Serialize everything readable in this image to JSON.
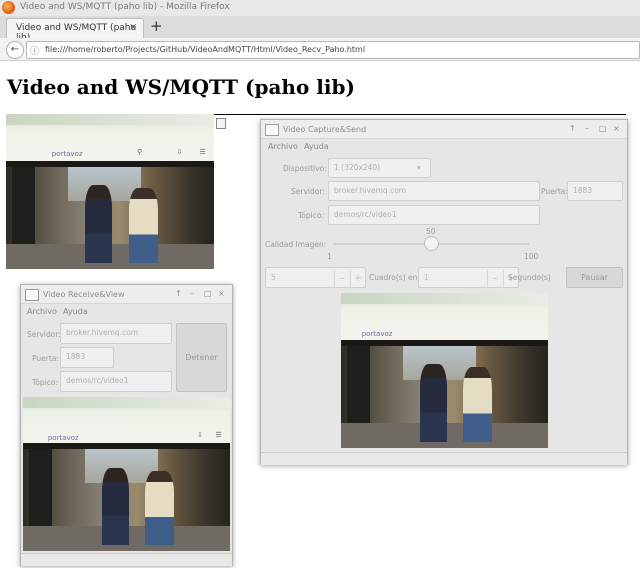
{
  "browser": {
    "window_title": "Video and WS/MQTT (paho lib) - Mozilla Firefox",
    "tab_label": "Video and WS/MQTT (paho lib)",
    "tab_close": "×",
    "new_tab": "+",
    "back": "←",
    "info": "ⓘ",
    "url": "file:///home/roberto/Projects/GitHub/VideoAndMQTT/Html/Video_Recv_Paho.html"
  },
  "page": {
    "title": "Video and WS/MQTT (paho lib)"
  },
  "video": {
    "webpage_caption": "portavoz",
    "icons": [
      "⚲",
      "⇩",
      "☰"
    ]
  },
  "capture_window": {
    "title": "Video Capture&Send",
    "controls": [
      "↑",
      "–",
      "□",
      "×"
    ],
    "menu": [
      "Archivo",
      "Ayuda"
    ],
    "device_label": "Dispositivo:",
    "device_value": "1 (320x240)",
    "device_arrow": "▾",
    "server_label": "Servidor:",
    "server_value": "broker.hivemq.com",
    "port_label": "Puerta:",
    "port_value": "1883",
    "topic_label": "Tópico:",
    "topic_value": "demos/rc/video1",
    "quality_label": "Calidad Imagen:",
    "quality_value": 50,
    "quality_value_text": "50",
    "quality_min": "1",
    "quality_max": "100",
    "frames_value": "5",
    "frames_label": "Cuadro(s) en",
    "seconds_value": "1",
    "seconds_label": "Segundo(s)",
    "minus": "–",
    "plus": "+",
    "pause_button": "Pausar"
  },
  "receive_window": {
    "title": "Video Receive&View",
    "controls": [
      "↑",
      "–",
      "□",
      "×"
    ],
    "menu": [
      "Archivo",
      "Ayuda"
    ],
    "server_label": "Servidor:",
    "server_value": "broker.hivemq.com",
    "port_label": "Puerta:",
    "port_value": "1883",
    "topic_label": "Tópico:",
    "topic_value": "demos/rc/video1",
    "stop_button": "Detener"
  },
  "colors": {
    "link_caption": "#6d6fa3",
    "window_bg": "#e6e6e6",
    "firefox_orange": "#e1541b"
  }
}
